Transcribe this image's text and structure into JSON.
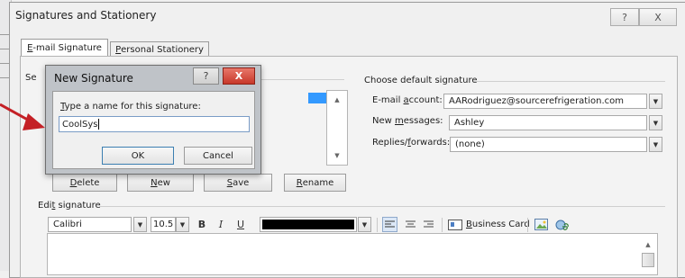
{
  "window": {
    "title": "Signatures and Stationery",
    "help_glyph": "?",
    "close_glyph": "X"
  },
  "tabs": [
    {
      "label_u": "E",
      "label_rest": "-mail Signature"
    },
    {
      "label_u": "P",
      "label_rest": "ersonal Stationery"
    }
  ],
  "select_signature": {
    "partial_label": "Se"
  },
  "signature_buttons": [
    {
      "label_u": "D",
      "label_rest": "elete"
    },
    {
      "label_u": "N",
      "label_rest": "ew"
    },
    {
      "label_u": "S",
      "label_rest": "ave"
    },
    {
      "label_u": "R",
      "label_rest": "ename"
    }
  ],
  "defaults": {
    "title": "Choose default signature",
    "email_account": {
      "pre": "E-mail ",
      "u": "a",
      "post": "ccount:",
      "value": "AARodriguez@sourcerefrigeration.com"
    },
    "new_messages": {
      "pre": "New ",
      "u": "m",
      "post": "essages:",
      "value": "Ashley"
    },
    "replies": {
      "pre": "Replies/",
      "u": "f",
      "post": "orwards:",
      "value": "(none)"
    }
  },
  "edit": {
    "title_pre": "Edi",
    "title_u": "t",
    "title_post": " signature",
    "font": "Calibri",
    "size": "10.5",
    "bold": "B",
    "italic": "I",
    "underline": "U",
    "business_card": {
      "u": "B",
      "rest": "usiness Card"
    }
  },
  "modal": {
    "title": "New Signature",
    "prompt_u": "T",
    "prompt_rest": "ype a name for this signature:",
    "input_value": "CoolSys",
    "ok": "OK",
    "cancel": "Cancel",
    "help_glyph": "?",
    "close_glyph": "X"
  },
  "colors": {
    "accent": "#3399ff",
    "arrow": "#c42026",
    "close_red": "#c7382a",
    "font_color_swatch": "#000000"
  }
}
